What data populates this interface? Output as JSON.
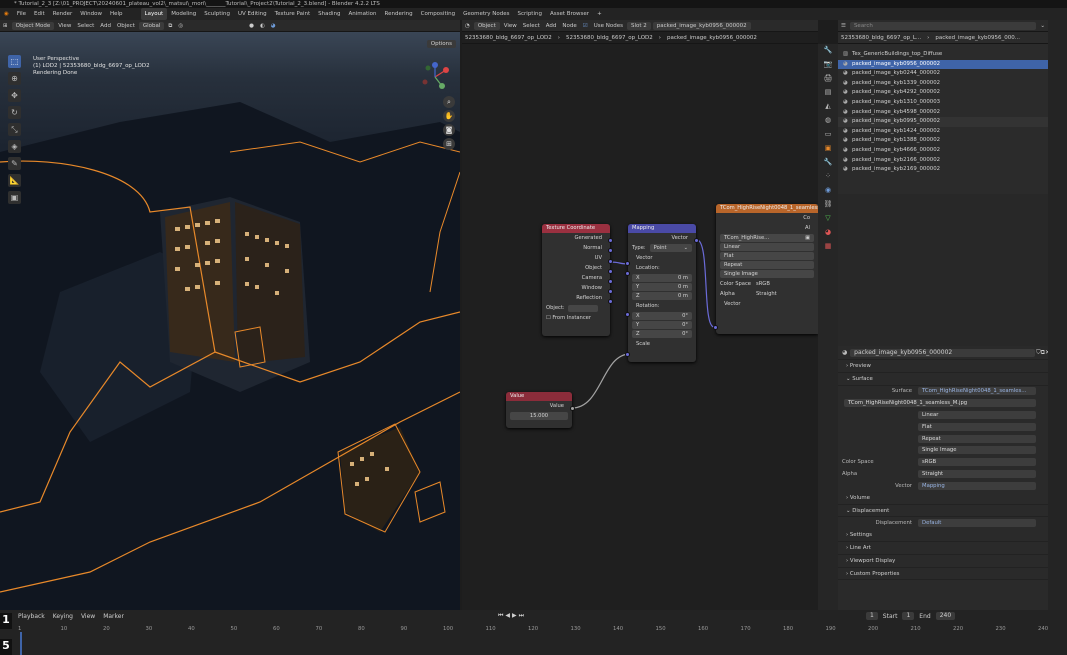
{
  "window_title": "* Tutorial_2_3 [Z:\\01_PROJECT\\20240601_plateau_vol2\\_matsui\\_mori\\_______Tutorial\\_Project2\\Tutorial_2_3.blend] - Blender 4.2.2 LTS",
  "menu": [
    "File",
    "Edit",
    "Render",
    "Window",
    "Help"
  ],
  "workspaces": [
    "Layout",
    "Modeling",
    "Sculpting",
    "UV Editing",
    "Texture Paint",
    "Shading",
    "Animation",
    "Rendering",
    "Compositing",
    "Geometry Nodes",
    "Scripting",
    "Asset Browser",
    "+"
  ],
  "active_workspace": "Layout",
  "search_placeholder": "Search",
  "viewport": {
    "mode": "Object Mode",
    "menus": [
      "View",
      "Select",
      "Add",
      "Object"
    ],
    "transform": "Global",
    "options_label": "Options",
    "info_line1": "User Perspective",
    "info_line2": "(1) LOD2 | 52353680_bldg_6697_op_LOD2",
    "info_line3": "Rendering Done"
  },
  "node_editor": {
    "type": "Object",
    "menus": [
      "View",
      "Select",
      "Add",
      "Node"
    ],
    "use_nodes": "Use Nodes",
    "slot": "Slot 2",
    "material": "packed_image_kyb0956_000002",
    "breadcrumb": [
      "52353680_bldg_6697_op_LOD2",
      "52353680_bldg_6697_op_LOD2",
      "packed_image_kyb0956_000002"
    ],
    "nodes": {
      "texcoord": {
        "title": "Texture Coordinate",
        "outputs": [
          "Generated",
          "Normal",
          "UV",
          "Object",
          "Camera",
          "Window",
          "Reflection"
        ],
        "object_label": "Object:",
        "from_instancer": "From Instancer"
      },
      "mapping": {
        "title": "Mapping",
        "out": "Vector",
        "type_label": "Type:",
        "type_value": "Point",
        "vector_in": "Vector",
        "location_label": "Location:",
        "loc": [
          {
            "k": "X",
            "v": "0 m"
          },
          {
            "k": "Y",
            "v": "0 m"
          },
          {
            "k": "Z",
            "v": "0 m"
          }
        ],
        "rotation_label": "Rotation:",
        "rot": [
          {
            "k": "X",
            "v": "0°"
          },
          {
            "k": "Y",
            "v": "0°"
          },
          {
            "k": "Z",
            "v": "0°"
          }
        ],
        "scale": "Scale"
      },
      "value": {
        "title": "Value",
        "out": "Value",
        "value": "15.000"
      },
      "image": {
        "title": "TCom_HighRiseNight0048_1_seamless",
        "image_name": "TCom_HighRise...",
        "interp": "Linear",
        "proj": "Flat",
        "ext": "Repeat",
        "source": "Single Image",
        "cs_label": "Color Space",
        "cs": "sRGB",
        "alpha_label": "Alpha",
        "alpha": "Straight",
        "vector": "Vector",
        "out_color": "Co",
        "out_alpha": "Al"
      }
    }
  },
  "outliner": {
    "breadcrumb1": "52353680_bldg_6697_op_L...",
    "breadcrumb2": "packed_image_kyb0956_000...",
    "items": [
      "Tex_GenericBuildings_top_Diffuse",
      "packed_image_kyb0956_000002",
      "packed_image_kyb0244_000002",
      "packed_image_kyb1339_000002",
      "packed_image_kyb4292_000002",
      "packed_image_kyb1310_000003",
      "packed_image_kyb4598_000002",
      "packed_image_kyb0995_000002",
      "packed_image_kyb1424_000002",
      "packed_image_kyb1388_000002",
      "packed_image_kyb4666_000002",
      "packed_image_kyb2166_000002",
      "packed_image_kyb2169_000002"
    ],
    "selected_index": 1
  },
  "properties": {
    "material": "packed_image_kyb0956_000002",
    "preview": "Preview",
    "surface": "Surface",
    "surface_label": "Surface",
    "surface_value": "TCom_HighRiseNight0048_1_seamles...",
    "image_file": "TCom_HighRiseNight0048_1_seamless_M.jpg",
    "interp": "Linear",
    "proj": "Flat",
    "ext": "Repeat",
    "source": "Single Image",
    "cs_label": "Color Space",
    "cs": "sRGB",
    "alpha_label": "Alpha",
    "alpha": "Straight",
    "vector_label": "Vector",
    "vector_value": "Mapping",
    "sections": [
      "Volume",
      "Displacement"
    ],
    "disp_label": "Displacement",
    "disp_value": "Default",
    "tail_sections": [
      "Settings",
      "Line Art",
      "Viewport Display",
      "Custom Properties"
    ]
  },
  "timeline": {
    "menus": [
      "Playback",
      "Keying",
      "View",
      "Marker"
    ],
    "current": "1",
    "start_label": "Start",
    "start": "1",
    "end_label": "End",
    "end": "240",
    "ticks": [
      "1",
      "10",
      "20",
      "30",
      "40",
      "50",
      "60",
      "70",
      "80",
      "90",
      "100",
      "110",
      "120",
      "130",
      "140",
      "150",
      "160",
      "170",
      "180",
      "190",
      "200",
      "210",
      "220",
      "230",
      "240"
    ],
    "corner_a": "1",
    "corner_b": "5"
  },
  "colors": {
    "accent": "#3f64a8",
    "outline": "#e8892a",
    "node_value": "#8b2c3a",
    "node_mapping": "#4a4aa6",
    "node_texcoord": "#9a3040",
    "node_image": "#b8652a"
  }
}
